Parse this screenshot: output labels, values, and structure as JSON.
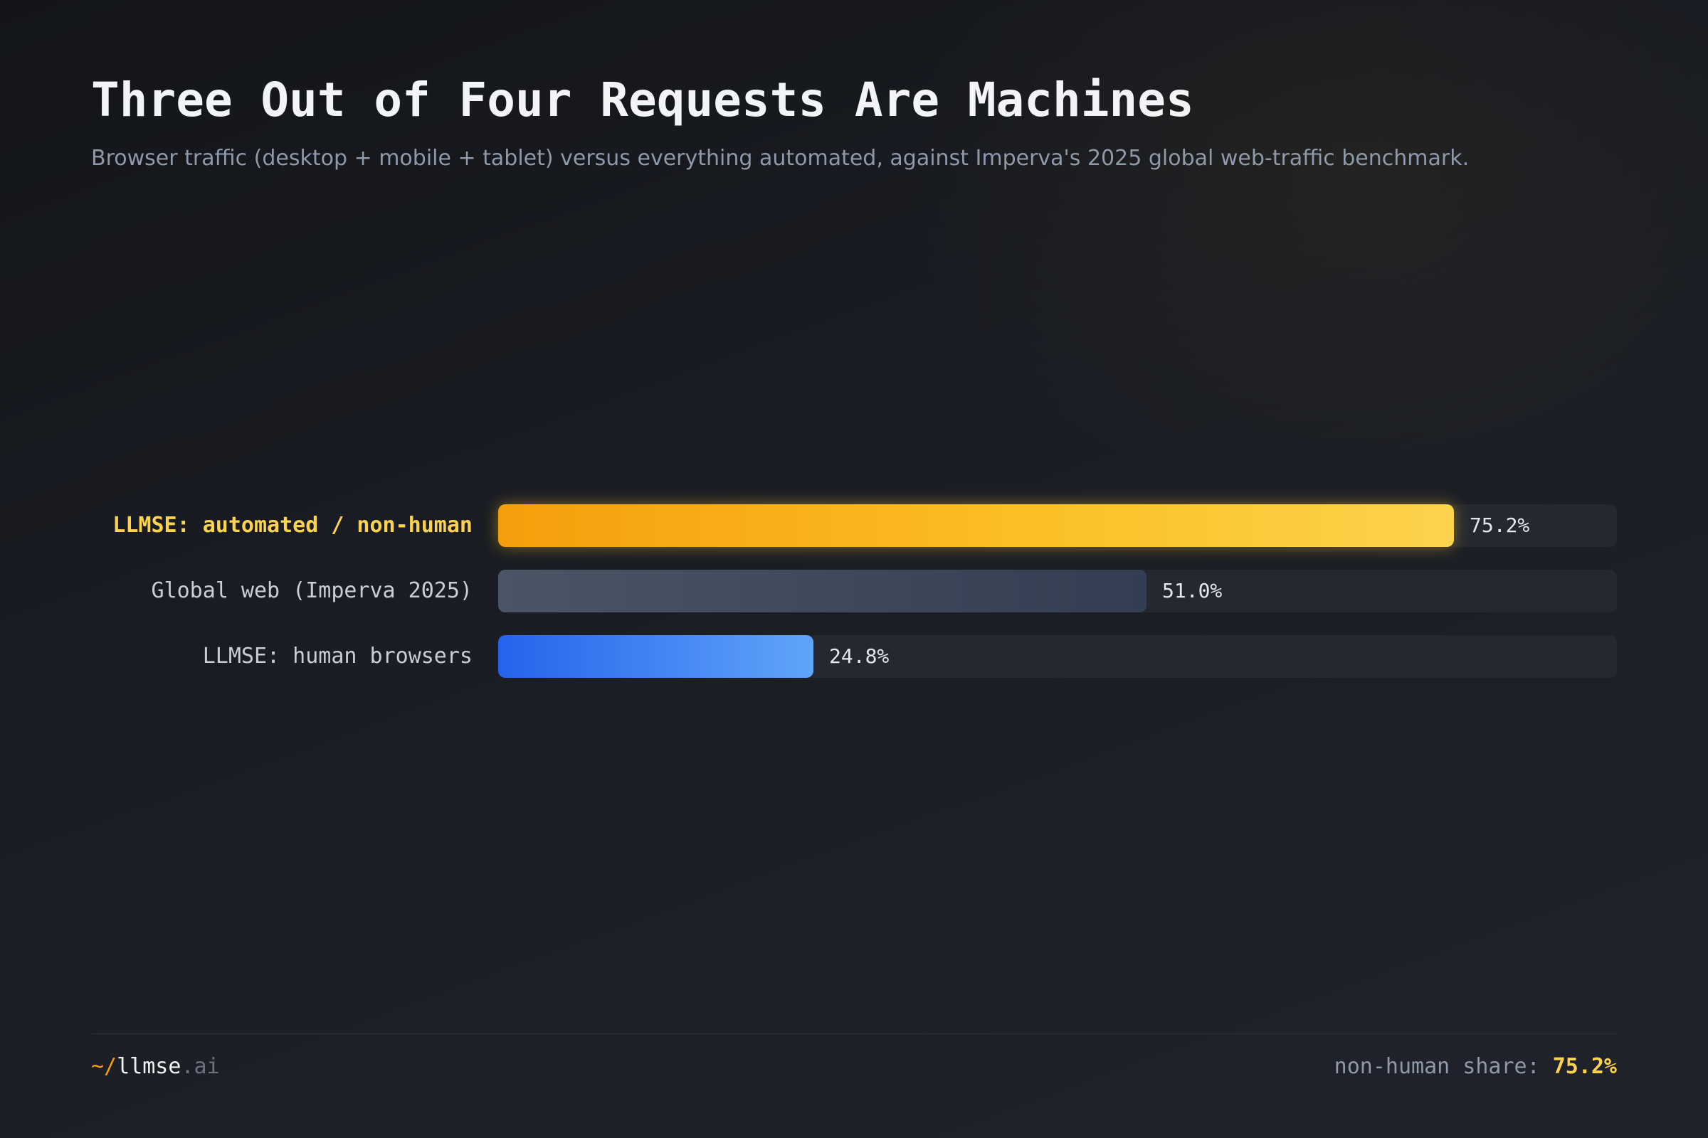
{
  "header": {
    "title": "Three Out of Four Requests Are Machines",
    "subtitle": "Browser traffic (desktop + mobile + tablet) versus everything automated, against Imperva's 2025 global web-traffic benchmark."
  },
  "chart_data": {
    "type": "bar",
    "orientation": "horizontal",
    "title": "Three Out of Four Requests Are Machines",
    "subtitle": "Browser traffic (desktop + mobile + tablet) versus everything automated, against Imperva's 2025 global web-traffic benchmark.",
    "categories": [
      "LLMSE: automated / non-human",
      "Global web (Imperva 2025)",
      "LLMSE: human browsers"
    ],
    "values": [
      75.2,
      51.0,
      24.8
    ],
    "value_labels": [
      "75.2%",
      "51.0%",
      "24.8%"
    ],
    "unit": "%",
    "xlim": [
      0,
      88
    ],
    "grid": false,
    "colors": [
      "#fbbf24",
      "#3f4a5c",
      "#3b82f6"
    ],
    "highlight_index": 0
  },
  "footer": {
    "brand_prefix": "~/",
    "brand_name": "llmse",
    "brand_tld": ".ai",
    "share_label": "non-human share: ",
    "share_value": "75.2%"
  }
}
